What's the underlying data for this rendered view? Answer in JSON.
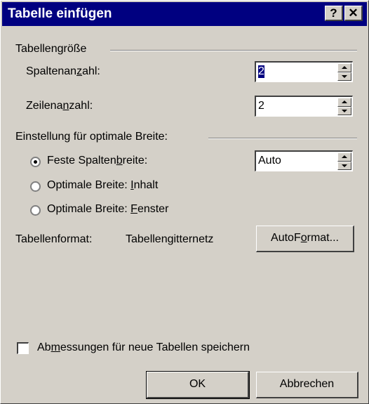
{
  "window": {
    "title": "Tabelle einfügen",
    "help_label": "?",
    "close_label": "✕"
  },
  "size_group": {
    "title": "Tabellengröße",
    "columns_label": "Spaltenanzahl:",
    "columns_value": "2",
    "rows_label": "Zeilenanzahl:",
    "rows_value": "2"
  },
  "width_group": {
    "title": "Einstellung für optimale Breite:",
    "fixed_label": "Feste Spaltenbreite:",
    "fixed_value": "Auto",
    "content_label": "Optimale Breite: Inhalt",
    "window_label": "Optimale Breite: Fenster",
    "selected": "fixed"
  },
  "format": {
    "label": "Tabellenformat:",
    "value": "Tabellengitternetz",
    "autoformat_button": "AutoFormat..."
  },
  "remember_checkbox": {
    "label": "Abmessungen für neue Tabellen speichern",
    "checked": false
  },
  "buttons": {
    "ok": "OK",
    "cancel": "Abbrechen"
  }
}
